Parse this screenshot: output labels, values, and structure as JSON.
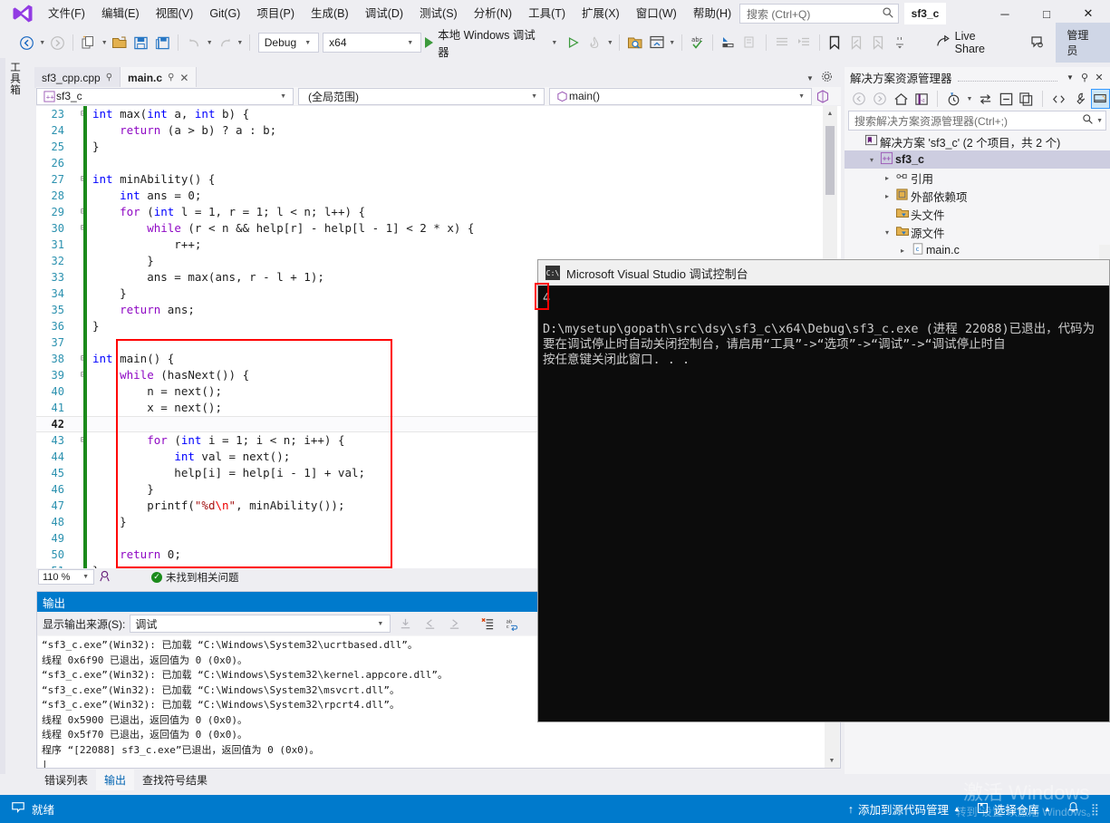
{
  "window": {
    "title_project": "sf3_c",
    "minimize": "─",
    "maximize": "□",
    "close": "✕"
  },
  "menu": {
    "items": [
      {
        "label": "文件(F)"
      },
      {
        "label": "编辑(E)"
      },
      {
        "label": "视图(V)"
      },
      {
        "label": "Git(G)"
      },
      {
        "label": "项目(P)"
      },
      {
        "label": "生成(B)"
      },
      {
        "label": "调试(D)"
      },
      {
        "label": "测试(S)"
      },
      {
        "label": "分析(N)"
      },
      {
        "label": "工具(T)"
      },
      {
        "label": "扩展(X)"
      },
      {
        "label": "窗口(W)"
      },
      {
        "label": "帮助(H)"
      }
    ]
  },
  "search": {
    "placeholder": "搜索 (Ctrl+Q)",
    "icon": "search-icon"
  },
  "toolbar": {
    "config": "Debug",
    "platform": "x64",
    "start_label": "本地 Windows 调试器",
    "live_share": "Live Share",
    "admin": "管理员"
  },
  "toolbox_tab": "工具箱",
  "tabs": {
    "items": [
      {
        "label": "sf3_cpp.cpp",
        "active": false,
        "pinned": true,
        "closable": false
      },
      {
        "label": "main.c",
        "active": true,
        "pinned": true,
        "closable": true
      }
    ]
  },
  "navbar": {
    "project": "sf3_c",
    "scope": "(全局范围)",
    "member": "main()"
  },
  "editor": {
    "first_line": 23,
    "current_line": 42,
    "zoom": "110 %",
    "issues": "未找到相关问题",
    "lines": [
      {
        "n": 23,
        "glyph": "⊟",
        "html": "<span class=\"kw\">int</span> max(<span class=\"kw\">int</span> a, <span class=\"kw\">int</span> b) {"
      },
      {
        "n": 24,
        "glyph": "",
        "html": "    <span class=\"ctl\">return</span> (a &gt; b) ? a : b;"
      },
      {
        "n": 25,
        "glyph": "",
        "html": "}"
      },
      {
        "n": 26,
        "glyph": "",
        "html": ""
      },
      {
        "n": 27,
        "glyph": "⊟",
        "html": "<span class=\"kw\">int</span> minAbility() {"
      },
      {
        "n": 28,
        "glyph": "",
        "html": "    <span class=\"kw\">int</span> ans = 0;"
      },
      {
        "n": 29,
        "glyph": "⊟",
        "html": "    <span class=\"ctl\">for</span> (<span class=\"kw\">int</span> l = 1, r = 1; l &lt; n; l++) {"
      },
      {
        "n": 30,
        "glyph": "⊟",
        "html": "        <span class=\"ctl\">while</span> (r &lt; n &amp;&amp; help[r] - help[l - 1] &lt; 2 * x) {"
      },
      {
        "n": 31,
        "glyph": "",
        "html": "            r++;"
      },
      {
        "n": 32,
        "glyph": "",
        "html": "        }"
      },
      {
        "n": 33,
        "glyph": "",
        "html": "        ans = max(ans, r - l + 1);"
      },
      {
        "n": 34,
        "glyph": "",
        "html": "    }"
      },
      {
        "n": 35,
        "glyph": "",
        "html": "    <span class=\"ctl\">return</span> ans;"
      },
      {
        "n": 36,
        "glyph": "",
        "html": "}"
      },
      {
        "n": 37,
        "glyph": "",
        "html": ""
      },
      {
        "n": 38,
        "glyph": "⊟",
        "html": "<span class=\"kw\">int</span> main() {"
      },
      {
        "n": 39,
        "glyph": "⊟",
        "html": "    <span class=\"ctl\">while</span> (hasNext()) {"
      },
      {
        "n": 40,
        "glyph": "",
        "html": "        n = next();"
      },
      {
        "n": 41,
        "glyph": "",
        "html": "        x = next();"
      },
      {
        "n": 42,
        "glyph": "",
        "html": ""
      },
      {
        "n": 43,
        "glyph": "⊟",
        "html": "        <span class=\"ctl\">for</span> (<span class=\"kw\">int</span> i = 1; i &lt; n; i++) {"
      },
      {
        "n": 44,
        "glyph": "",
        "html": "            <span class=\"kw\">int</span> val = next();"
      },
      {
        "n": 45,
        "glyph": "",
        "html": "            help[i] = help[i - 1] + val;"
      },
      {
        "n": 46,
        "glyph": "",
        "html": "        }"
      },
      {
        "n": 47,
        "glyph": "",
        "html": "        printf(<span class=\"str\">\"%d</span><span class=\"esc\">\\n</span><span class=\"str\">\"</span>, minAbility());"
      },
      {
        "n": 48,
        "glyph": "",
        "html": "    }"
      },
      {
        "n": 49,
        "glyph": "",
        "html": ""
      },
      {
        "n": 50,
        "glyph": "",
        "html": "    <span class=\"ctl\">return</span> 0;"
      },
      {
        "n": 51,
        "glyph": "",
        "html": "}"
      }
    ]
  },
  "output": {
    "title": "输出",
    "source_label": "显示输出来源(S):",
    "source_value": "调试",
    "lines": [
      "“sf3_c.exe”(Win32): 已加载 “C:\\Windows\\System32\\ucrtbased.dll”。",
      "线程 0x6f90 已退出，返回值为 0 (0x0)。",
      "“sf3_c.exe”(Win32): 已加载 “C:\\Windows\\System32\\kernel.appcore.dll”。",
      "“sf3_c.exe”(Win32): 已加载 “C:\\Windows\\System32\\msvcrt.dll”。",
      "“sf3_c.exe”(Win32): 已加载 “C:\\Windows\\System32\\rpcrt4.dll”。",
      "线程 0x5900 已退出，返回值为 0 (0x0)。",
      "线程 0x5f70 已退出，返回值为 0 (0x0)。",
      "程序 “[22088] sf3_c.exe”已退出，返回值为 0 (0x0)。",
      "|"
    ]
  },
  "bottom_tabs": {
    "items": [
      {
        "label": "错误列表",
        "active": false
      },
      {
        "label": "输出",
        "active": true
      },
      {
        "label": "查找符号结果",
        "active": false
      }
    ]
  },
  "solution_explorer": {
    "title": "解决方案资源管理器",
    "search_placeholder": "搜索解决方案资源管理器(Ctrl+;)",
    "tree": [
      {
        "indent": 0,
        "arrow": "",
        "icon": "solution-icon",
        "label": "解决方案 'sf3_c' (2 个项目，共 2 个)",
        "selected": false,
        "bold": false
      },
      {
        "indent": 1,
        "arrow": "▾",
        "icon": "project-icon",
        "label": "sf3_c",
        "selected": true,
        "bold": true
      },
      {
        "indent": 2,
        "arrow": "▸",
        "icon": "references-icon",
        "label": "引用",
        "selected": false,
        "bold": false
      },
      {
        "indent": 2,
        "arrow": "▸",
        "icon": "dependencies-icon",
        "label": "外部依赖项",
        "selected": false,
        "bold": false
      },
      {
        "indent": 2,
        "arrow": "",
        "icon": "folder-icon",
        "label": "头文件",
        "selected": false,
        "bold": false
      },
      {
        "indent": 2,
        "arrow": "▾",
        "icon": "folder-icon",
        "label": "源文件",
        "selected": false,
        "bold": false
      },
      {
        "indent": 3,
        "arrow": "▸",
        "icon": "c-file-icon",
        "label": "main.c",
        "selected": false,
        "bold": false
      }
    ]
  },
  "console": {
    "title": "Microsoft Visual Studio 调试控制台",
    "program_output": "4",
    "lines": [
      "D:\\mysetup\\gopath\\src\\dsy\\sf3_c\\x64\\Debug\\sf3_c.exe (进程 22088)已退出，代码为",
      "要在调试停止时自动关闭控制台，请启用“工具”->“选项”->“调试”->“调试停止时自",
      "按任意键关闭此窗口. . ."
    ]
  },
  "statusbar": {
    "ready": "就绪",
    "source_control": "添加到源代码管理",
    "repo": "选择仓库"
  },
  "watermark": {
    "line1": "激活 Windows",
    "line2": "转到\"设置\"以激活 Windows。"
  },
  "colors": {
    "accent": "#007acc",
    "chrome": "#eeeef2",
    "editor_bg": "#ffffff",
    "console_bg": "#0c0c0c",
    "highlight_red": "#ff0000",
    "change_bar_green": "#1b8a1b"
  }
}
